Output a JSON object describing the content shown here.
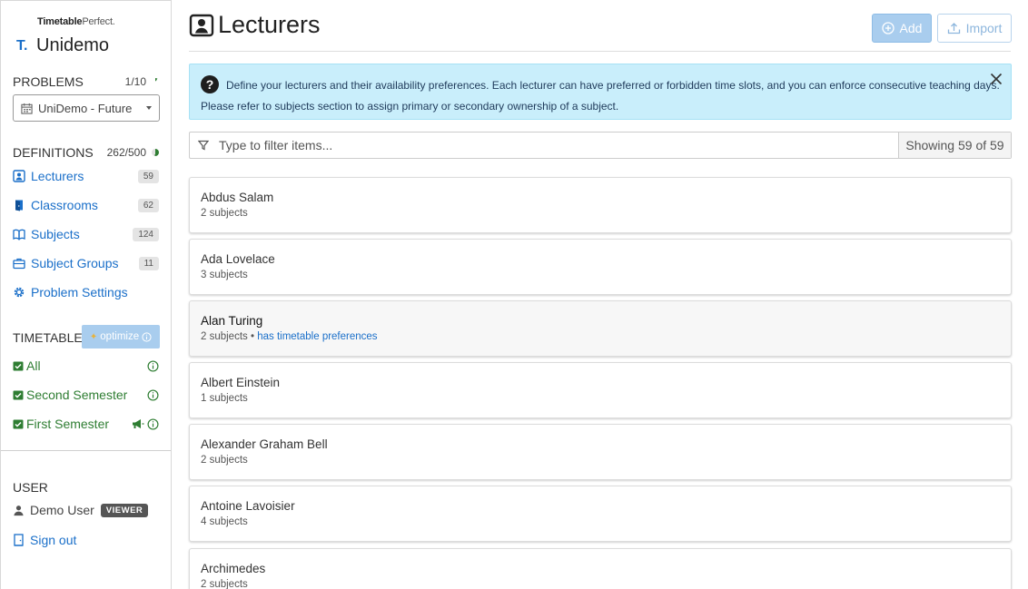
{
  "brand": {
    "small_bold": "Timetable",
    "small_rest": "Perfect.",
    "logo": "T.",
    "name": "Unidemo"
  },
  "problems": {
    "title": "PROBLEMS",
    "count": "1/10",
    "select_value": "UniDemo - Future"
  },
  "definitions": {
    "title": "DEFINITIONS",
    "count": "262/500",
    "items": [
      {
        "label": "Lecturers",
        "badge": "59",
        "icon": "lecturer-icon"
      },
      {
        "label": "Classrooms",
        "badge": "62",
        "icon": "door-icon"
      },
      {
        "label": "Subjects",
        "badge": "124",
        "icon": "book-icon"
      },
      {
        "label": "Subject Groups",
        "badge": "11",
        "icon": "briefcase-icon"
      },
      {
        "label": "Problem Settings",
        "badge": "",
        "icon": "gear-icon"
      }
    ]
  },
  "timetables": {
    "title": "TIMETABLES",
    "optimize_label": "optimize",
    "items": [
      {
        "label": "All"
      },
      {
        "label": "Second Semester"
      },
      {
        "label": "First Semester"
      }
    ]
  },
  "user": {
    "title": "USER",
    "name": "Demo User",
    "role": "VIEWER",
    "signout": "Sign out"
  },
  "page": {
    "title": "Lecturers",
    "add_label": "Add",
    "import_label": "Import",
    "info_line1": "Define your lecturers and their availability preferences. Each lecturer can have preferred or forbidden time slots, and you can enforce consecutive teaching days.",
    "info_line2": "Please refer to subjects section to assign primary or secondary ownership of a subject.",
    "filter_placeholder": "Type to filter items...",
    "showing": "Showing 59 of 59"
  },
  "lecturers": [
    {
      "name": "Abdus Salam",
      "subjects": "2 subjects",
      "pref": ""
    },
    {
      "name": "Ada Lovelace",
      "subjects": "3 subjects",
      "pref": ""
    },
    {
      "name": "Alan Turing",
      "subjects": "2 subjects",
      "pref": "has timetable preferences"
    },
    {
      "name": "Albert Einstein",
      "subjects": "1 subjects",
      "pref": ""
    },
    {
      "name": "Alexander Graham Bell",
      "subjects": "2 subjects",
      "pref": ""
    },
    {
      "name": "Antoine Lavoisier",
      "subjects": "4 subjects",
      "pref": ""
    },
    {
      "name": "Archimedes",
      "subjects": "2 subjects",
      "pref": ""
    }
  ],
  "colors": {
    "link_blue": "#1a6fc9",
    "green": "#2e7d32",
    "info_bg": "#c9eefb",
    "button_blue": "#a9cdee"
  }
}
